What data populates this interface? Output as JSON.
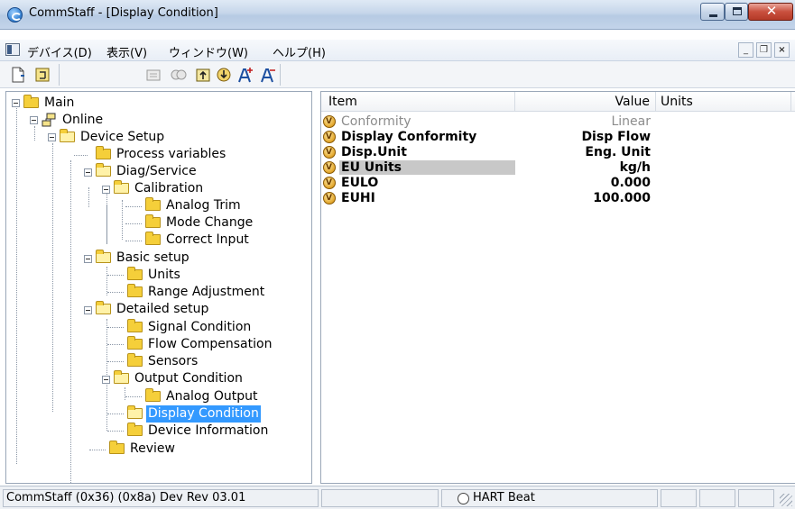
{
  "window": {
    "title": "CommStaff - [Display Condition]"
  },
  "menu": {
    "device": "デバイス(D)",
    "view": "表示(V)",
    "window": "ウィンドウ(W)",
    "help": "ヘルプ(H)"
  },
  "toolbar": {
    "icons": [
      "new-icon",
      "online-icon",
      "read-icon",
      "compare-icon",
      "upload-icon",
      "download-icon",
      "font-increase-icon",
      "font-decrease-icon"
    ]
  },
  "tree": {
    "main": "Main",
    "online": "Online",
    "device_setup": "Device Setup",
    "process_variables": "Process variables",
    "diag_service": "Diag/Service",
    "calibration": "Calibration",
    "analog_trim": "Analog Trim",
    "mode_change": "Mode Change",
    "correct_input": "Correct Input",
    "basic_setup": "Basic setup",
    "units": "Units",
    "range_adjustment": "Range Adjustment",
    "detailed_setup": "Detailed setup",
    "signal_condition": "Signal Condition",
    "flow_compensation": "Flow Compensation",
    "sensors": "Sensors",
    "output_condition": "Output Condition",
    "analog_output": "Analog Output",
    "display_condition": "Display Condition",
    "device_information": "Device Information",
    "review": "Review"
  },
  "list": {
    "headers": {
      "item": "Item",
      "value": "Value",
      "units": "Units"
    },
    "rows": [
      {
        "item": "Conformity",
        "value": "Linear"
      },
      {
        "item": "Display Conformity",
        "value": "Disp Flow"
      },
      {
        "item": "Disp.Unit",
        "value": "Eng. Unit"
      },
      {
        "item": "EU Units",
        "value": "kg/h"
      },
      {
        "item": "EULO",
        "value": "0.000"
      },
      {
        "item": "EUHI",
        "value": "100.000"
      }
    ]
  },
  "status": {
    "main": "CommStaff  (0x36)  (0x8a) Dev Rev 03.01",
    "hart": "HART Beat"
  },
  "colors": {
    "selection": "#3399ff",
    "folder": "#f5cf3a",
    "close_button": "#c9503e"
  }
}
